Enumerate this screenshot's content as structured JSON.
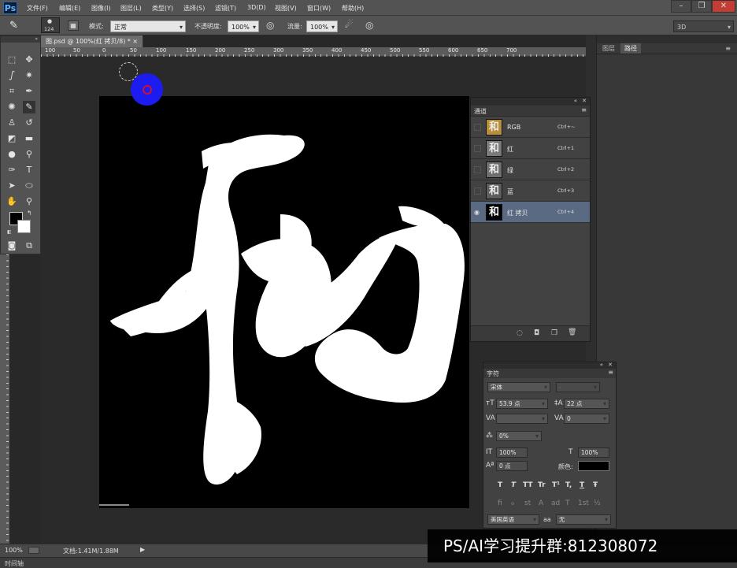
{
  "menubar": {
    "logo": "Ps",
    "items": [
      "文件(F)",
      "编辑(E)",
      "图像(I)",
      "图层(L)",
      "类型(Y)",
      "选择(S)",
      "滤镜(T)",
      "3D(D)",
      "视图(V)",
      "窗口(W)",
      "帮助(H)"
    ]
  },
  "options": {
    "brush_size": "124",
    "mode_label": "模式:",
    "mode_value": "正常",
    "opacity_label": "不透明度:",
    "opacity_value": "100%",
    "flow_label": "流量:",
    "flow_value": "100%",
    "workspace": "3D"
  },
  "doc_tab": {
    "title": "图.psd @ 100%(红 拷贝/8) *",
    "close": "×"
  },
  "ruler_top": [
    "100",
    "50",
    "0",
    "50",
    "100",
    "150",
    "200",
    "250",
    "300",
    "350",
    "400",
    "450",
    "500",
    "550",
    "600",
    "650",
    "700"
  ],
  "panels": {
    "layers_tab": "图层",
    "paths_tab": "路径"
  },
  "channels": {
    "title": "通道",
    "rows": [
      {
        "name": "RGB",
        "key": "Ctrl+~",
        "thumb": "#b98f3c",
        "visible": false,
        "selected": false
      },
      {
        "name": "红",
        "key": "Ctrl+1",
        "thumb": "#7a7a7a",
        "visible": false,
        "selected": false
      },
      {
        "name": "绿",
        "key": "Ctrl+2",
        "thumb": "#6e6e6e",
        "visible": false,
        "selected": false
      },
      {
        "name": "蓝",
        "key": "Ctrl+3",
        "thumb": "#5e5e5e",
        "visible": false,
        "selected": false
      },
      {
        "name": "红 拷贝",
        "key": "Ctrl+4",
        "thumb": "#000000",
        "visible": true,
        "selected": true
      }
    ]
  },
  "character": {
    "title": "字符",
    "font_family": "宋体",
    "font_style": "-",
    "font_size": "53.9 点",
    "leading": "22 点",
    "kerning": "",
    "tracking": "0",
    "scale_pct": "0%",
    "vscale": "100%",
    "hscale": "100%",
    "baseline": "0 点",
    "color_label": "颜色:",
    "language": "美国英语",
    "aa_label": "aa",
    "aa_value": "无",
    "styles": [
      "T",
      "T",
      "TT",
      "Tr",
      "T¹",
      "T,",
      "T",
      "Ŧ"
    ],
    "ot": [
      "fi",
      "ℴ",
      "st",
      "A",
      "ad",
      "T",
      "1st",
      "½"
    ]
  },
  "status": {
    "zoom": "100%",
    "docinfo": "文档:1.41M/1.88M",
    "timeline": "时间轴"
  },
  "watermark": "PS/AI学习提升群:812308072",
  "colors": {
    "brush_cursor": "#1c1cf0",
    "accent_ring": "#d0102c",
    "selected_row": "#5a6a82"
  }
}
